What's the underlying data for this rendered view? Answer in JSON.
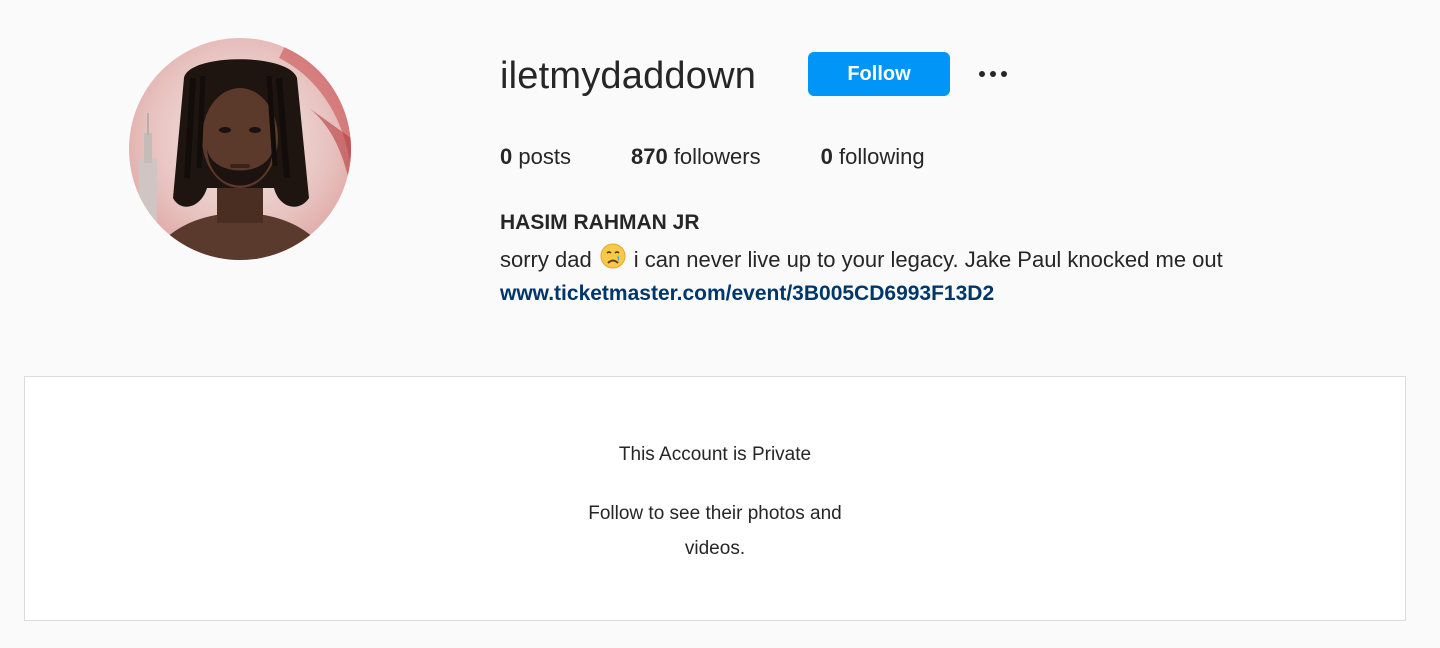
{
  "profile": {
    "username": "iletmydaddown",
    "follow_label": "Follow",
    "more_icon": "more-horizontal-icon",
    "stats": {
      "posts_count": "0",
      "posts_label": "posts",
      "followers_count": "870",
      "followers_label": "followers",
      "following_count": "0",
      "following_label": "following"
    },
    "full_name": "HASIM RAHMAN JR",
    "bio_before_emoji": "sorry dad",
    "bio_emoji": "crying-face-emoji",
    "bio_after_emoji": "i can never live up to your legacy. Jake Paul knocked me out",
    "link": "www.ticketmaster.com/event/3B005CD6993F13D2"
  },
  "private_notice": {
    "title": "This Account is Private",
    "subtitle": "Follow to see their photos and videos."
  },
  "colors": {
    "accent": "#0095f6",
    "link": "#00376b",
    "background": "#fafafa",
    "text": "#262626",
    "border": "#dbdbdb"
  }
}
